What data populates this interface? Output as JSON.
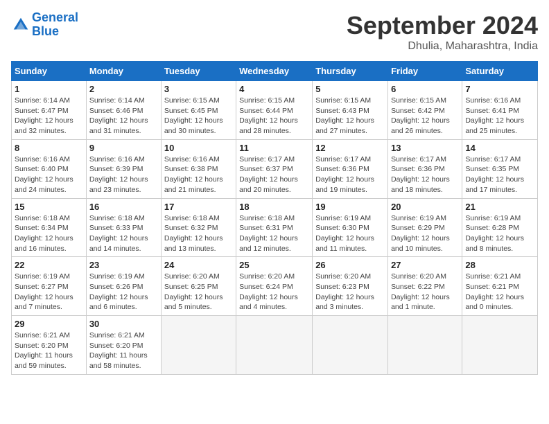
{
  "header": {
    "logo_line1": "General",
    "logo_line2": "Blue",
    "month": "September 2024",
    "location": "Dhulia, Maharashtra, India"
  },
  "days_of_week": [
    "Sunday",
    "Monday",
    "Tuesday",
    "Wednesday",
    "Thursday",
    "Friday",
    "Saturday"
  ],
  "weeks": [
    [
      {
        "day": "1",
        "info": "Sunrise: 6:14 AM\nSunset: 6:47 PM\nDaylight: 12 hours\nand 32 minutes."
      },
      {
        "day": "2",
        "info": "Sunrise: 6:14 AM\nSunset: 6:46 PM\nDaylight: 12 hours\nand 31 minutes."
      },
      {
        "day": "3",
        "info": "Sunrise: 6:15 AM\nSunset: 6:45 PM\nDaylight: 12 hours\nand 30 minutes."
      },
      {
        "day": "4",
        "info": "Sunrise: 6:15 AM\nSunset: 6:44 PM\nDaylight: 12 hours\nand 28 minutes."
      },
      {
        "day": "5",
        "info": "Sunrise: 6:15 AM\nSunset: 6:43 PM\nDaylight: 12 hours\nand 27 minutes."
      },
      {
        "day": "6",
        "info": "Sunrise: 6:15 AM\nSunset: 6:42 PM\nDaylight: 12 hours\nand 26 minutes."
      },
      {
        "day": "7",
        "info": "Sunrise: 6:16 AM\nSunset: 6:41 PM\nDaylight: 12 hours\nand 25 minutes."
      }
    ],
    [
      {
        "day": "8",
        "info": "Sunrise: 6:16 AM\nSunset: 6:40 PM\nDaylight: 12 hours\nand 24 minutes."
      },
      {
        "day": "9",
        "info": "Sunrise: 6:16 AM\nSunset: 6:39 PM\nDaylight: 12 hours\nand 23 minutes."
      },
      {
        "day": "10",
        "info": "Sunrise: 6:16 AM\nSunset: 6:38 PM\nDaylight: 12 hours\nand 21 minutes."
      },
      {
        "day": "11",
        "info": "Sunrise: 6:17 AM\nSunset: 6:37 PM\nDaylight: 12 hours\nand 20 minutes."
      },
      {
        "day": "12",
        "info": "Sunrise: 6:17 AM\nSunset: 6:36 PM\nDaylight: 12 hours\nand 19 minutes."
      },
      {
        "day": "13",
        "info": "Sunrise: 6:17 AM\nSunset: 6:36 PM\nDaylight: 12 hours\nand 18 minutes."
      },
      {
        "day": "14",
        "info": "Sunrise: 6:17 AM\nSunset: 6:35 PM\nDaylight: 12 hours\nand 17 minutes."
      }
    ],
    [
      {
        "day": "15",
        "info": "Sunrise: 6:18 AM\nSunset: 6:34 PM\nDaylight: 12 hours\nand 16 minutes."
      },
      {
        "day": "16",
        "info": "Sunrise: 6:18 AM\nSunset: 6:33 PM\nDaylight: 12 hours\nand 14 minutes."
      },
      {
        "day": "17",
        "info": "Sunrise: 6:18 AM\nSunset: 6:32 PM\nDaylight: 12 hours\nand 13 minutes."
      },
      {
        "day": "18",
        "info": "Sunrise: 6:18 AM\nSunset: 6:31 PM\nDaylight: 12 hours\nand 12 minutes."
      },
      {
        "day": "19",
        "info": "Sunrise: 6:19 AM\nSunset: 6:30 PM\nDaylight: 12 hours\nand 11 minutes."
      },
      {
        "day": "20",
        "info": "Sunrise: 6:19 AM\nSunset: 6:29 PM\nDaylight: 12 hours\nand 10 minutes."
      },
      {
        "day": "21",
        "info": "Sunrise: 6:19 AM\nSunset: 6:28 PM\nDaylight: 12 hours\nand 8 minutes."
      }
    ],
    [
      {
        "day": "22",
        "info": "Sunrise: 6:19 AM\nSunset: 6:27 PM\nDaylight: 12 hours\nand 7 minutes."
      },
      {
        "day": "23",
        "info": "Sunrise: 6:19 AM\nSunset: 6:26 PM\nDaylight: 12 hours\nand 6 minutes."
      },
      {
        "day": "24",
        "info": "Sunrise: 6:20 AM\nSunset: 6:25 PM\nDaylight: 12 hours\nand 5 minutes."
      },
      {
        "day": "25",
        "info": "Sunrise: 6:20 AM\nSunset: 6:24 PM\nDaylight: 12 hours\nand 4 minutes."
      },
      {
        "day": "26",
        "info": "Sunrise: 6:20 AM\nSunset: 6:23 PM\nDaylight: 12 hours\nand 3 minutes."
      },
      {
        "day": "27",
        "info": "Sunrise: 6:20 AM\nSunset: 6:22 PM\nDaylight: 12 hours\nand 1 minute."
      },
      {
        "day": "28",
        "info": "Sunrise: 6:21 AM\nSunset: 6:21 PM\nDaylight: 12 hours\nand 0 minutes."
      }
    ],
    [
      {
        "day": "29",
        "info": "Sunrise: 6:21 AM\nSunset: 6:20 PM\nDaylight: 11 hours\nand 59 minutes."
      },
      {
        "day": "30",
        "info": "Sunrise: 6:21 AM\nSunset: 6:20 PM\nDaylight: 11 hours\nand 58 minutes."
      },
      {
        "day": "",
        "info": ""
      },
      {
        "day": "",
        "info": ""
      },
      {
        "day": "",
        "info": ""
      },
      {
        "day": "",
        "info": ""
      },
      {
        "day": "",
        "info": ""
      }
    ]
  ]
}
